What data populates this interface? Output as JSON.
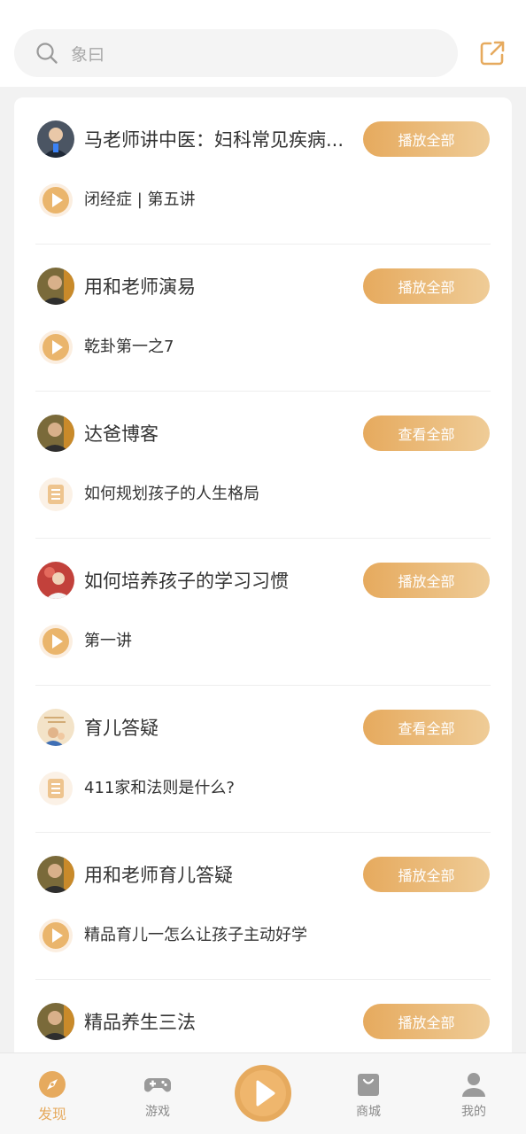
{
  "search": {
    "placeholder": "象曰"
  },
  "icons": {
    "search": "search-icon",
    "share": "share-icon",
    "play": "play-icon",
    "document": "document-icon"
  },
  "colors": {
    "accent": "#e6aa5e",
    "accent_light": "#efcc97",
    "background": "#f2f2f2",
    "card": "#ffffff"
  },
  "groups": [
    {
      "title": "马老师讲中医：妇科常见疾病...",
      "button": "播放全部",
      "item": "闭经症 | 第五讲",
      "item_type": "audio"
    },
    {
      "title": "用和老师演易",
      "button": "播放全部",
      "item": "乾卦第一之7",
      "item_type": "audio"
    },
    {
      "title": "达爸博客",
      "button": "查看全部",
      "item": "如何规划孩子的人生格局",
      "item_type": "article"
    },
    {
      "title": "如何培养孩子的学习习惯",
      "button": "播放全部",
      "item": "第一讲",
      "item_type": "audio"
    },
    {
      "title": "育儿答疑",
      "button": "查看全部",
      "item": "411家和法则是什么?",
      "item_type": "article"
    },
    {
      "title": "用和老师育儿答疑",
      "button": "播放全部",
      "item": "精品育儿一怎么让孩子主动好学",
      "item_type": "audio"
    },
    {
      "title": "精品养生三法",
      "button": "播放全部"
    }
  ],
  "tabbar": {
    "discover": {
      "label": "发现",
      "icon": "compass-icon",
      "active": true
    },
    "games": {
      "label": "游戏",
      "icon": "gamepad-icon"
    },
    "play": {
      "icon": "play-icon"
    },
    "mall": {
      "label": "商城",
      "icon": "shopping-bag-icon"
    },
    "mine": {
      "label": "我的",
      "icon": "user-icon"
    }
  }
}
